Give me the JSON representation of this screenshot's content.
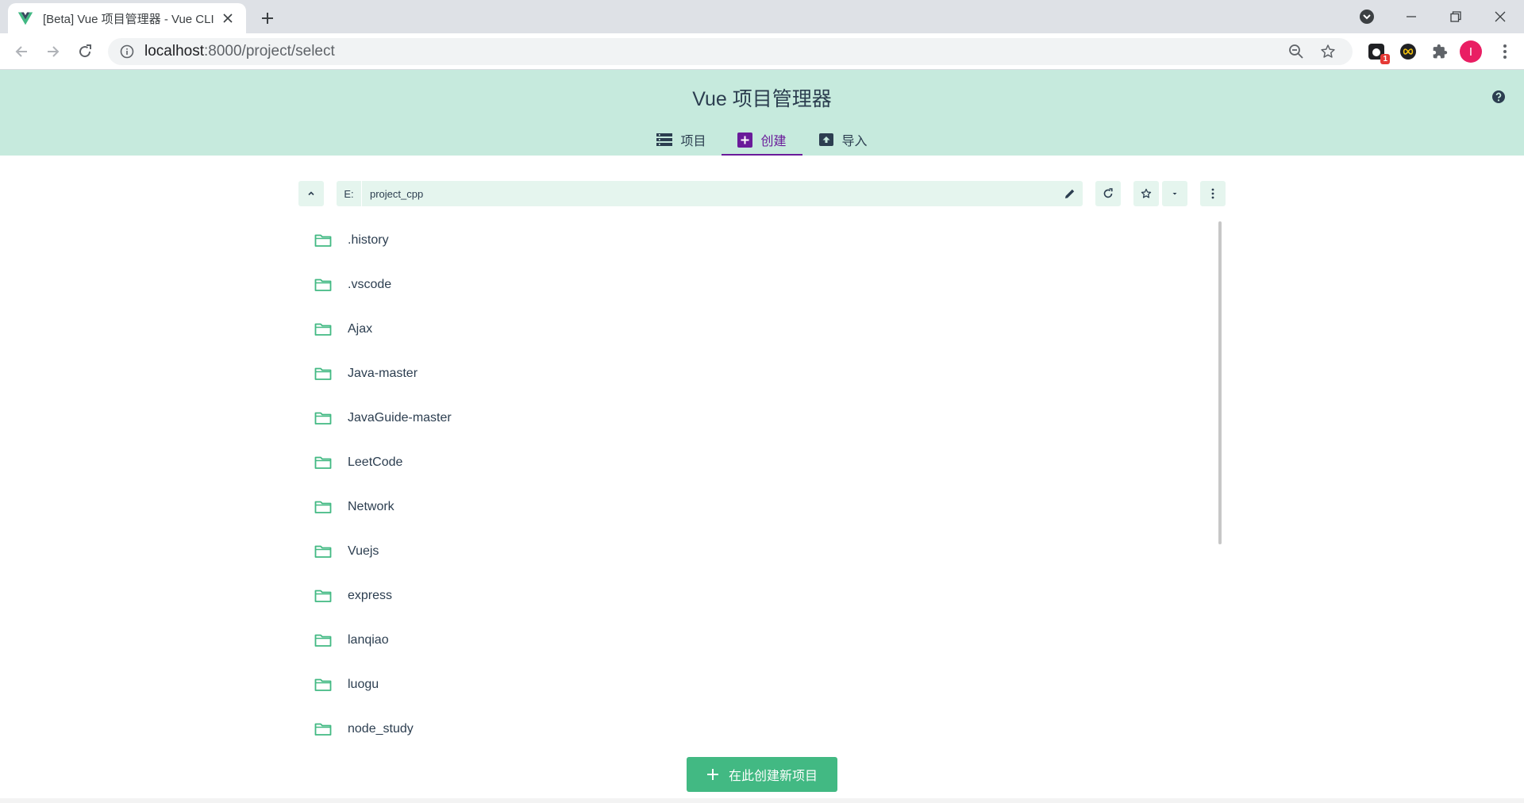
{
  "browser": {
    "tab_title": "[Beta] Vue 项目管理器 - Vue CLI",
    "url_host": "localhost",
    "url_path": ":8000/project/select",
    "extension_badge": "1",
    "profile_initial": "I"
  },
  "header": {
    "title": "Vue 项目管理器",
    "tabs": [
      {
        "label": "项目",
        "icon": "list-icon"
      },
      {
        "label": "创建",
        "icon": "add-box-icon",
        "active": true
      },
      {
        "label": "导入",
        "icon": "unarchive-icon"
      }
    ]
  },
  "explorer": {
    "drive": "E:",
    "current_folder": "project_cpp",
    "folders": [
      ".history",
      ".vscode",
      "Ajax",
      "Java-master",
      "JavaGuide-master",
      "LeetCode",
      "Network",
      "Vuejs",
      "express",
      "lanqiao",
      "luogu",
      "node_study"
    ]
  },
  "actions": {
    "create_label": "在此创建新项目"
  },
  "colors": {
    "header_bg": "#c6eadd",
    "accent": "#42b983",
    "active_tab": "#6a1b9a",
    "field_bg": "#e5f5ee"
  }
}
